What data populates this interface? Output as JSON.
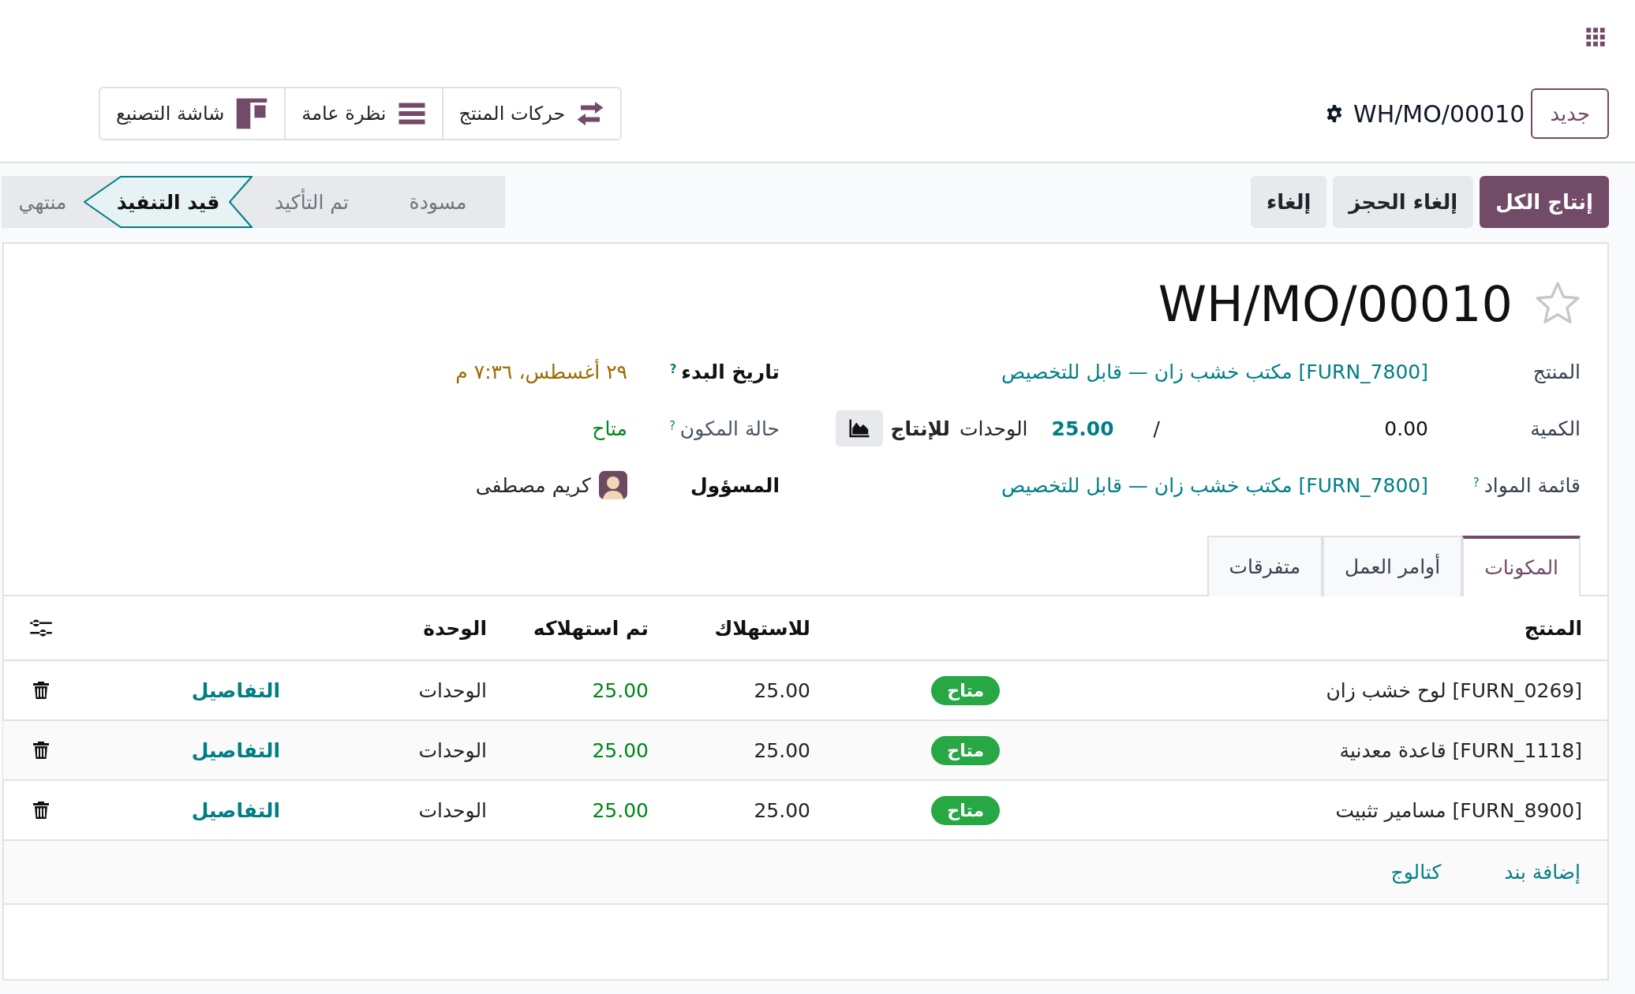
{
  "breadcrumb": {
    "new_button": "جديد",
    "record": "WH/MO/00010"
  },
  "smart_buttons": [
    {
      "label": "حركات المنتج",
      "kind": "moves"
    },
    {
      "label": "نظرة عامة",
      "kind": "overview"
    },
    {
      "label": "شاشة التصنيع",
      "kind": "shopfloor"
    }
  ],
  "actions": [
    {
      "label": "إنتاج الكل",
      "primary": true
    },
    {
      "label": "إلغاء الحجز",
      "primary": false
    },
    {
      "label": "إلغاء",
      "primary": false
    }
  ],
  "status_steps": [
    {
      "label": "مسودة",
      "selected": false
    },
    {
      "label": "تم التأكيد",
      "selected": false
    },
    {
      "label": "قيد التنفيذ",
      "selected": true
    },
    {
      "label": "منتهي",
      "selected": false
    }
  ],
  "title": "WH/MO/00010",
  "favorite": false,
  "fields_main": [
    {
      "kind": "link",
      "label": "المنتج",
      "value": "[FURN_7800] مكتب خشب زان — قابل للتخصيص"
    },
    {
      "kind": "quantity",
      "label": "الكمية",
      "produced": "0.00",
      "separator": "/",
      "target": "25.00",
      "unit": "الوحدات",
      "unit_suffix": "للإنتاج"
    },
    {
      "kind": "link",
      "label": "قائمة المواد",
      "help": "?",
      "value": "[FURN_7800] مكتب خشب زان — قابل للتخصيص"
    }
  ],
  "fields_side": [
    {
      "kind": "date",
      "label": "تاريخ البدء",
      "help": "?",
      "muted": false,
      "value": "٢٩ أغسطس، ٧:٣٦ م"
    },
    {
      "kind": "status",
      "label": "حالة المكون",
      "help": "?",
      "muted": true,
      "value": "متاح"
    },
    {
      "kind": "user",
      "label": "المسؤول",
      "muted": false,
      "value": "كريم مصطفى"
    }
  ],
  "tabs": [
    {
      "label": "المكونات",
      "selected": true
    },
    {
      "label": "أوامر العمل",
      "selected": false
    },
    {
      "label": "متفرقات",
      "selected": false
    }
  ],
  "table": {
    "columns": [
      "المنتج",
      "للاستهلاك",
      "تم استهلاكه",
      "الوحدة"
    ],
    "rows": [
      {
        "product": "[FURN_0269] لوح خشب زان",
        "availability": "متاح",
        "to_consume": "25.00",
        "consumed": "25.00",
        "unit": "الوحدات",
        "details": "التفاصيل"
      },
      {
        "product": "[FURN_1118] قاعدة معدنية",
        "availability": "متاح",
        "to_consume": "25.00",
        "consumed": "25.00",
        "unit": "الوحدات",
        "details": "التفاصيل"
      },
      {
        "product": "[FURN_8900] مسامير تثبيت",
        "availability": "متاح",
        "to_consume": "25.00",
        "consumed": "25.00",
        "unit": "الوحدات",
        "details": "التفاصيل"
      }
    ],
    "add_line": "إضافة بند",
    "catalog": "كتالوج"
  }
}
